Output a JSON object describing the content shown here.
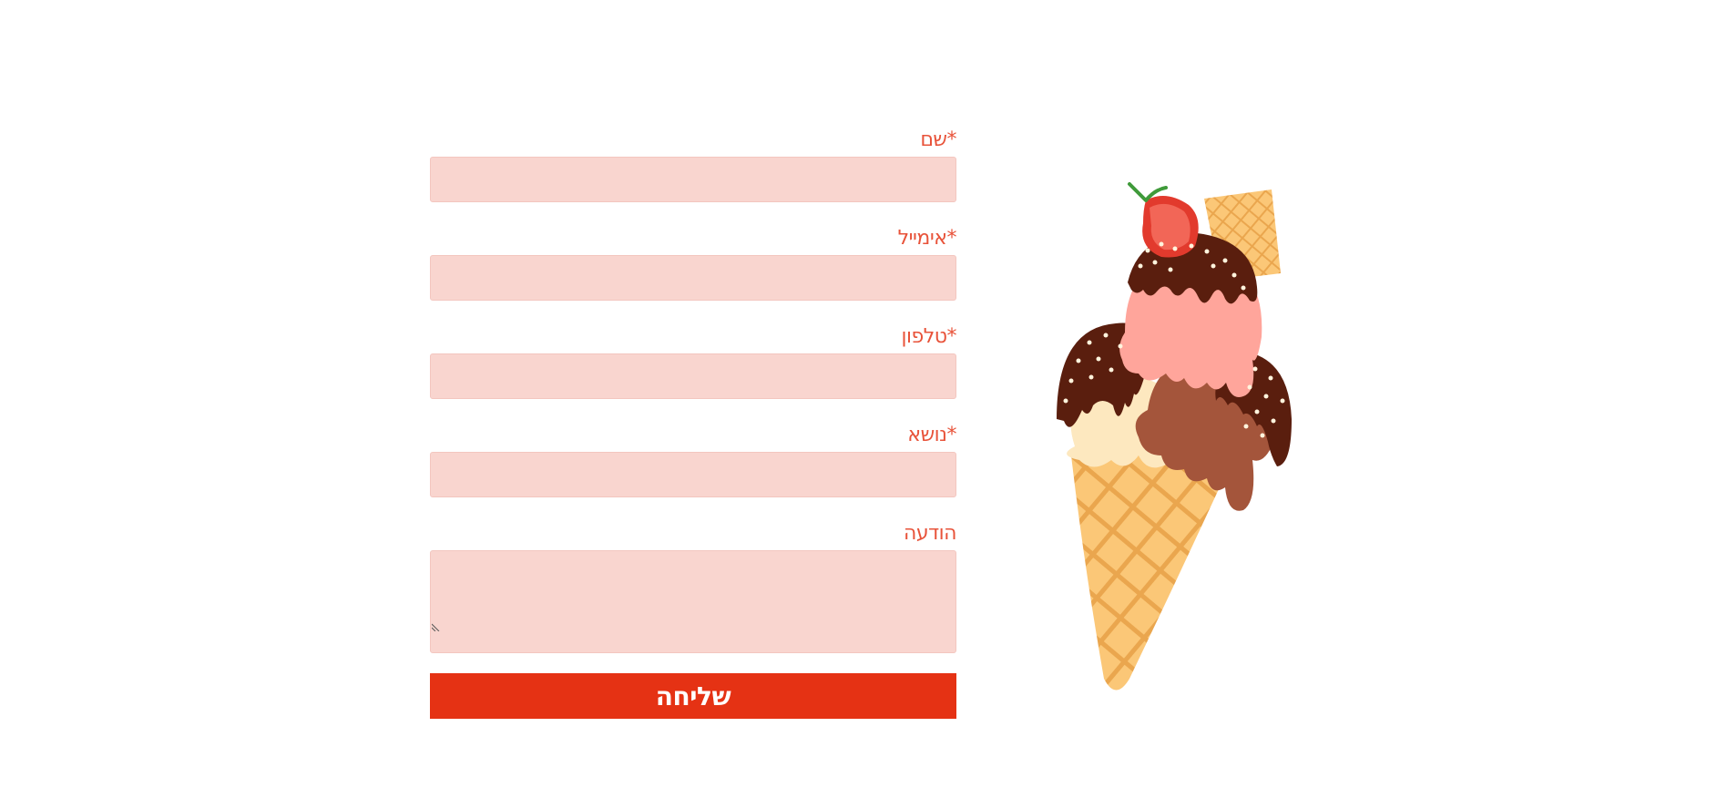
{
  "form": {
    "fields": [
      {
        "label": "שם",
        "required": "*"
      },
      {
        "label": "אימייל",
        "required": "*"
      },
      {
        "label": "טלפון",
        "required": "*"
      },
      {
        "label": "נושא",
        "required": "*"
      }
    ],
    "message_label": "הודעה",
    "submit_label": "שליחה"
  },
  "illustration": {
    "icon": "ice-cream-cone-icon"
  },
  "colors": {
    "label": "#e8533a",
    "field_bg": "#f9d5cf",
    "submit_bg": "#e53214"
  }
}
